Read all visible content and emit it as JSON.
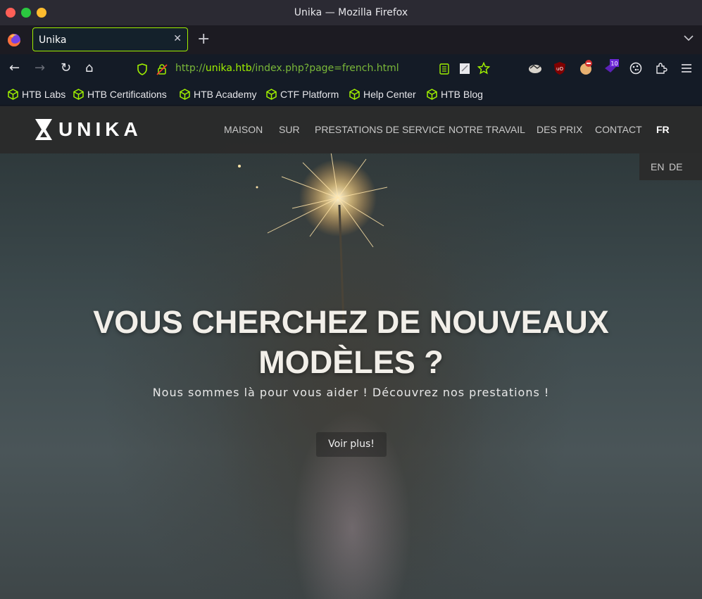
{
  "window": {
    "title": "Unika — Mozilla Firefox"
  },
  "tab": {
    "title": "Unika",
    "close": "✕",
    "new_tab": "+",
    "list": "⌄"
  },
  "nav": {
    "back": "←",
    "forward": "→",
    "reload": "↻",
    "home": "⌂"
  },
  "urlbar": {
    "scheme": "http://",
    "host": "unika.htb",
    "path": "/index.php?page=french.html"
  },
  "bookmarks": [
    {
      "label": "HTB Labs"
    },
    {
      "label": "HTB Certifications"
    },
    {
      "label": "HTB Academy"
    },
    {
      "label": "CTF Platform"
    },
    {
      "label": "Help Center"
    },
    {
      "label": "HTB Blog"
    }
  ],
  "extensions": {
    "badge_count": "10"
  },
  "site": {
    "brand": "UNIKA",
    "menu": [
      {
        "label": "MAISON"
      },
      {
        "label": "SUR"
      },
      {
        "label": "PRESTATIONS DE SERVICE"
      },
      {
        "label": "NOTRE TRAVAIL"
      },
      {
        "label": "DES PRIX"
      },
      {
        "label": "CONTACT"
      },
      {
        "label": "FR"
      }
    ],
    "languages": [
      "EN",
      "DE"
    ],
    "hero": {
      "title_line1": "VOUS CHERCHEZ DE NOUVEAUX",
      "title_line2": "MODÈLES ?",
      "subtitle": "Nous sommes là pour vous aider ! Découvrez nos prestations !",
      "button": "Voir plus!"
    }
  },
  "colors": {
    "accent": "#9fef00",
    "url_path": "#7ab839",
    "header_bg": "#2b2b2b"
  }
}
